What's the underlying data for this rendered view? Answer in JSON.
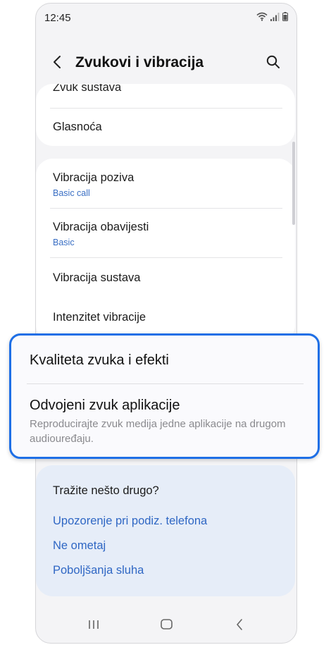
{
  "status_bar": {
    "time": "12:45"
  },
  "app_bar": {
    "title": "Zvukovi i vibracija"
  },
  "card1": {
    "items": [
      {
        "label": "Zvuk sustava"
      },
      {
        "label": "Glasnoća"
      }
    ]
  },
  "card2": {
    "items": [
      {
        "label": "Vibracija poziva",
        "sub": "Basic call"
      },
      {
        "label": "Vibracija obavijesti",
        "sub": "Basic"
      },
      {
        "label": "Vibracija sustava"
      },
      {
        "label": "Intenzitet vibracije"
      }
    ]
  },
  "highlight": {
    "item1": {
      "label": "Kvaliteta zvuka i efekti"
    },
    "item2": {
      "label": "Odvojeni zvuk aplikacije",
      "desc": "Reproducirajte zvuk medija jedne aplikacije na drugom audiouređaju."
    },
    "border_color": "#1e6fe6"
  },
  "suggestions": {
    "heading": "Tražite nešto drugo?",
    "links": [
      "Upozorenje pri podiz. telefona",
      "Ne ometaj",
      "Poboljšanja sluha"
    ],
    "link_color": "#2f67c4"
  },
  "nav_bar": {
    "icons": [
      "recents-icon",
      "home-icon",
      "back-icon"
    ]
  }
}
